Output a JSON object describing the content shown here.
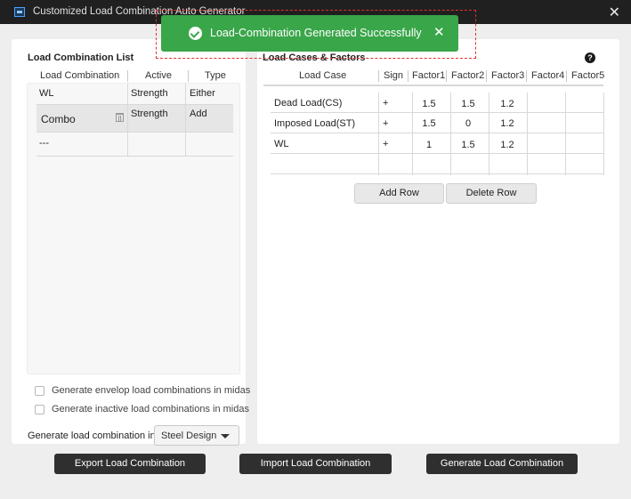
{
  "window": {
    "title": "Customized Load Combination Auto Generator"
  },
  "toast": {
    "message": "Load-Combination Generated Successfully"
  },
  "left": {
    "title": "Load Combination List",
    "headers": [
      "Load Combination",
      "Active",
      "Type"
    ],
    "rows": [
      {
        "name": "WL",
        "active": "Strength",
        "type": "Either"
      },
      {
        "name": "Combo",
        "active": "Strength",
        "type": "Add"
      },
      {
        "name": "---",
        "active": "",
        "type": ""
      }
    ],
    "options": [
      {
        "label": "Generate envelop load combinations in midas",
        "checked": false
      },
      {
        "label": "Generate inactive load combinations in midas",
        "checked": false
      }
    ],
    "generate_in_label": "Generate load combination in:",
    "generate_in_value": "Steel Design"
  },
  "right": {
    "title": "Load Cases & Factors",
    "headers": [
      "Load Case",
      "Sign",
      "Factor1",
      "Factor2",
      "Factor3",
      "Factor4",
      "Factor5"
    ],
    "rows": [
      {
        "case": "Dead Load(CS)",
        "sign": "+",
        "f1": "1.5",
        "f2": "1.5",
        "f3": "1.2",
        "f4": "",
        "f5": ""
      },
      {
        "case": "Imposed Load(ST)",
        "sign": "+",
        "f1": "1.5",
        "f2": "0",
        "f3": "1.2",
        "f4": "",
        "f5": ""
      },
      {
        "case": "WL",
        "sign": "+",
        "f1": "1",
        "f2": "1.5",
        "f3": "1.2",
        "f4": "",
        "f5": ""
      },
      {
        "case": "",
        "sign": "",
        "f1": "",
        "f2": "",
        "f3": "",
        "f4": "",
        "f5": ""
      }
    ],
    "add_row": "Add Row",
    "delete_row": "Delete Row",
    "help": "?"
  },
  "footer": {
    "export": "Export Load Combination",
    "import": "Import Load Combination",
    "generate": "Generate Load Combination"
  },
  "icons": [
    "app-icon",
    "close-icon",
    "check-circle-icon",
    "toast-close-icon",
    "trash-icon",
    "help-icon",
    "caret-down-icon"
  ],
  "colors": {
    "toast_bg": "#3aa64a",
    "toast_outline": "#e03030",
    "title_bar": "#202020",
    "footer_button": "#2f2f2f"
  }
}
